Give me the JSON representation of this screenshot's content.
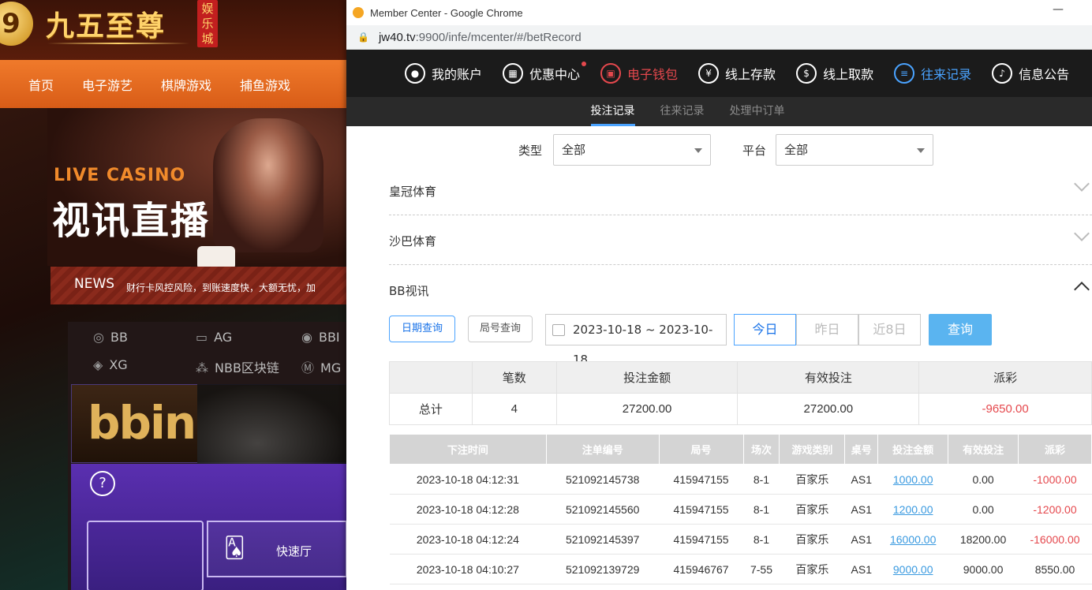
{
  "background_site": {
    "logo_text": "九五至尊",
    "logo_sub": "娱乐城",
    "nav": [
      "首页",
      "电子游艺",
      "棋牌游戏",
      "捕鱼游戏"
    ],
    "hero_en": "LIVE CASINO",
    "hero_cn": "视讯直播",
    "news_label": "NEWS",
    "news_text": "财行卡风控风险，到账速度快，大额无忧，加",
    "platforms": [
      "BB",
      "AG",
      "BBI",
      "XG",
      "NBB区块链",
      "MG"
    ],
    "bbin_logo": "bbin",
    "quick_hall": "快速厅"
  },
  "window": {
    "title": "Member Center - Google Chrome",
    "url_host": "jw40.tv",
    "url_rest": ":9900/infe/mcenter/#/betRecord"
  },
  "member_nav": [
    {
      "label": "我的账户",
      "icon": "user-icon",
      "state": "normal"
    },
    {
      "label": "优惠中心",
      "icon": "gift-icon",
      "state": "normal",
      "dot": true
    },
    {
      "label": "电子钱包",
      "icon": "wallet-icon",
      "state": "red"
    },
    {
      "label": "线上存款",
      "icon": "deposit-icon",
      "state": "normal"
    },
    {
      "label": "线上取款",
      "icon": "withdraw-icon",
      "state": "normal"
    },
    {
      "label": "往来记录",
      "icon": "records-icon",
      "state": "blue"
    },
    {
      "label": "信息公告",
      "icon": "bell-icon",
      "state": "normal"
    }
  ],
  "sub_tabs": [
    "投注记录",
    "往来记录",
    "处理中订单"
  ],
  "filters": {
    "type_label": "类型",
    "type_value": "全部",
    "platform_label": "平台",
    "platform_value": "全部"
  },
  "sections": [
    "皇冠体育",
    "沙巴体育",
    "BB视讯"
  ],
  "tools": {
    "date_query": "日期查询",
    "round_query": "局号查询",
    "date_range": "2023-10-18 ~ 2023-10-18",
    "today": "今日",
    "yesterday": "昨日",
    "last8": "近8日",
    "query": "查询"
  },
  "summary": {
    "headers": [
      "",
      "笔数",
      "投注金额",
      "有效投注",
      "派彩"
    ],
    "row": [
      "总计",
      "4",
      "27200.00",
      "27200.00",
      "-9650.00"
    ]
  },
  "detail": {
    "headers": [
      "下注时间",
      "注单编号",
      "局号",
      "场次",
      "游戏类别",
      "桌号",
      "投注金额",
      "有效投注",
      "派彩"
    ],
    "rows": [
      [
        "2023-10-18 04:12:31",
        "521092145738",
        "415947155",
        "8-1",
        "百家乐",
        "AS1",
        "1000.00",
        "0.00",
        "-1000.00"
      ],
      [
        "2023-10-18 04:12:28",
        "521092145560",
        "415947155",
        "8-1",
        "百家乐",
        "AS1",
        "1200.00",
        "0.00",
        "-1200.00"
      ],
      [
        "2023-10-18 04:12:24",
        "521092145397",
        "415947155",
        "8-1",
        "百家乐",
        "AS1",
        "16000.00",
        "18200.00",
        "-16000.00"
      ],
      [
        "2023-10-18 04:10:27",
        "521092139729",
        "415946767",
        "7-55",
        "百家乐",
        "AS1",
        "9000.00",
        "9000.00",
        "8550.00"
      ]
    ]
  },
  "colors": {
    "accent_blue": "#4aa3ff",
    "negative_red": "#e5484d",
    "nav_bg": "#1b1b1b"
  }
}
